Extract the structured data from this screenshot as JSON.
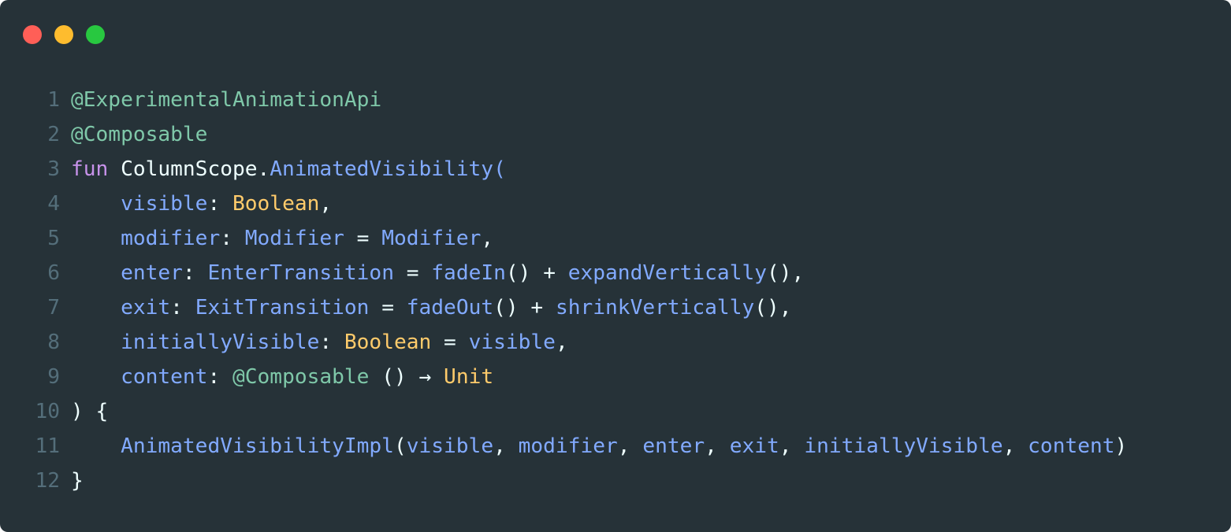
{
  "window": {
    "buttons": [
      {
        "name": "close",
        "color": "#ff5f57"
      },
      {
        "name": "minimize",
        "color": "#febc2e"
      },
      {
        "name": "maximize",
        "color": "#28c840"
      }
    ]
  },
  "colors": {
    "background": "#263238",
    "line_number": "#546e7a",
    "annotation": "#7fc8a9",
    "keyword": "#c792ea",
    "plain": "#eeffff",
    "function": "#82aaff",
    "type": "#ffcb6b",
    "punctuation": "#eeffff"
  },
  "code": {
    "lines": [
      {
        "n": "1",
        "tokens": [
          {
            "t": "@ExperimentalAnimationApi",
            "k": "annotation"
          }
        ]
      },
      {
        "n": "2",
        "tokens": [
          {
            "t": "@Composable",
            "k": "annotation"
          }
        ]
      },
      {
        "n": "3",
        "tokens": [
          {
            "t": "fun",
            "k": "keyword"
          },
          {
            "t": " ColumnScope.",
            "k": "plain"
          },
          {
            "t": "AnimatedVisibility",
            "k": "function"
          },
          {
            "t": "(",
            "k": "function"
          }
        ]
      },
      {
        "n": "4",
        "tokens": [
          {
            "t": "    ",
            "k": "plain"
          },
          {
            "t": "visible",
            "k": "function"
          },
          {
            "t": ": ",
            "k": "plain"
          },
          {
            "t": "Boolean",
            "k": "type"
          },
          {
            "t": ",",
            "k": "plain"
          }
        ]
      },
      {
        "n": "5",
        "tokens": [
          {
            "t": "    ",
            "k": "plain"
          },
          {
            "t": "modifier",
            "k": "function"
          },
          {
            "t": ": ",
            "k": "plain"
          },
          {
            "t": "Modifier",
            "k": "function"
          },
          {
            "t": " = ",
            "k": "plain"
          },
          {
            "t": "Modifier",
            "k": "function"
          },
          {
            "t": ",",
            "k": "plain"
          }
        ]
      },
      {
        "n": "6",
        "tokens": [
          {
            "t": "    ",
            "k": "plain"
          },
          {
            "t": "enter",
            "k": "function"
          },
          {
            "t": ": ",
            "k": "plain"
          },
          {
            "t": "EnterTransition",
            "k": "function"
          },
          {
            "t": " = ",
            "k": "plain"
          },
          {
            "t": "fadeIn",
            "k": "function"
          },
          {
            "t": "() + ",
            "k": "plain"
          },
          {
            "t": "expandVertically",
            "k": "function"
          },
          {
            "t": "(),",
            "k": "plain"
          }
        ]
      },
      {
        "n": "7",
        "tokens": [
          {
            "t": "    ",
            "k": "plain"
          },
          {
            "t": "exit",
            "k": "function"
          },
          {
            "t": ": ",
            "k": "plain"
          },
          {
            "t": "ExitTransition",
            "k": "function"
          },
          {
            "t": " = ",
            "k": "plain"
          },
          {
            "t": "fadeOut",
            "k": "function"
          },
          {
            "t": "() + ",
            "k": "plain"
          },
          {
            "t": "shrinkVertically",
            "k": "function"
          },
          {
            "t": "(),",
            "k": "plain"
          }
        ]
      },
      {
        "n": "8",
        "tokens": [
          {
            "t": "    ",
            "k": "plain"
          },
          {
            "t": "initiallyVisible",
            "k": "function"
          },
          {
            "t": ": ",
            "k": "plain"
          },
          {
            "t": "Boolean",
            "k": "type"
          },
          {
            "t": " = ",
            "k": "plain"
          },
          {
            "t": "visible",
            "k": "function"
          },
          {
            "t": ",",
            "k": "plain"
          }
        ]
      },
      {
        "n": "9",
        "tokens": [
          {
            "t": "    ",
            "k": "plain"
          },
          {
            "t": "content",
            "k": "function"
          },
          {
            "t": ": ",
            "k": "plain"
          },
          {
            "t": "@Composable",
            "k": "annotation"
          },
          {
            "t": " () → ",
            "k": "plain"
          },
          {
            "t": "Unit",
            "k": "type"
          }
        ]
      },
      {
        "n": "10",
        "tokens": [
          {
            "t": ") {",
            "k": "plain"
          }
        ]
      },
      {
        "n": "11",
        "tokens": [
          {
            "t": "    ",
            "k": "plain"
          },
          {
            "t": "AnimatedVisibilityImpl",
            "k": "function"
          },
          {
            "t": "(",
            "k": "plain"
          },
          {
            "t": "visible",
            "k": "function"
          },
          {
            "t": ", ",
            "k": "plain"
          },
          {
            "t": "modifier",
            "k": "function"
          },
          {
            "t": ", ",
            "k": "plain"
          },
          {
            "t": "enter",
            "k": "function"
          },
          {
            "t": ", ",
            "k": "plain"
          },
          {
            "t": "exit",
            "k": "function"
          },
          {
            "t": ", ",
            "k": "plain"
          },
          {
            "t": "initiallyVisible",
            "k": "function"
          },
          {
            "t": ", ",
            "k": "plain"
          },
          {
            "t": "content",
            "k": "function"
          },
          {
            "t": ")",
            "k": "plain"
          }
        ]
      },
      {
        "n": "12",
        "tokens": [
          {
            "t": "}",
            "k": "plain"
          }
        ]
      }
    ]
  }
}
